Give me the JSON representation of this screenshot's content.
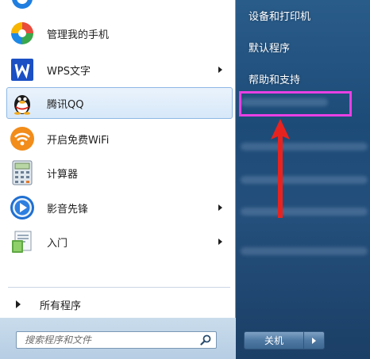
{
  "start_menu": {
    "programs": [
      {
        "label": "管理我的手机",
        "icon": "phone-manager-icon",
        "has_submenu": false,
        "selected": false
      },
      {
        "label": "WPS文字",
        "icon": "wps-writer-icon",
        "has_submenu": true,
        "selected": false
      },
      {
        "label": "腾讯QQ",
        "icon": "qq-penguin-icon",
        "has_submenu": false,
        "selected": true
      },
      {
        "label": "开启免费WiFi",
        "icon": "wifi-icon",
        "has_submenu": false,
        "selected": false
      },
      {
        "label": "计算器",
        "icon": "calculator-icon",
        "has_submenu": false,
        "selected": false
      },
      {
        "label": "影音先锋",
        "icon": "media-player-icon",
        "has_submenu": true,
        "selected": false
      },
      {
        "label": "入门",
        "icon": "getting-started-icon",
        "has_submenu": true,
        "selected": false
      }
    ],
    "all_programs_label": "所有程序",
    "search": {
      "placeholder": "搜索程序和文件"
    },
    "right_links": [
      {
        "label": "设备和打印机"
      },
      {
        "label": "默认程序"
      },
      {
        "label": "帮助和支持"
      }
    ],
    "shutdown_label": "关机"
  },
  "colors": {
    "highlight_box": "#e940e4",
    "annotation_arrow": "#e8231f",
    "selected_item_bg": "#dbeafa"
  }
}
